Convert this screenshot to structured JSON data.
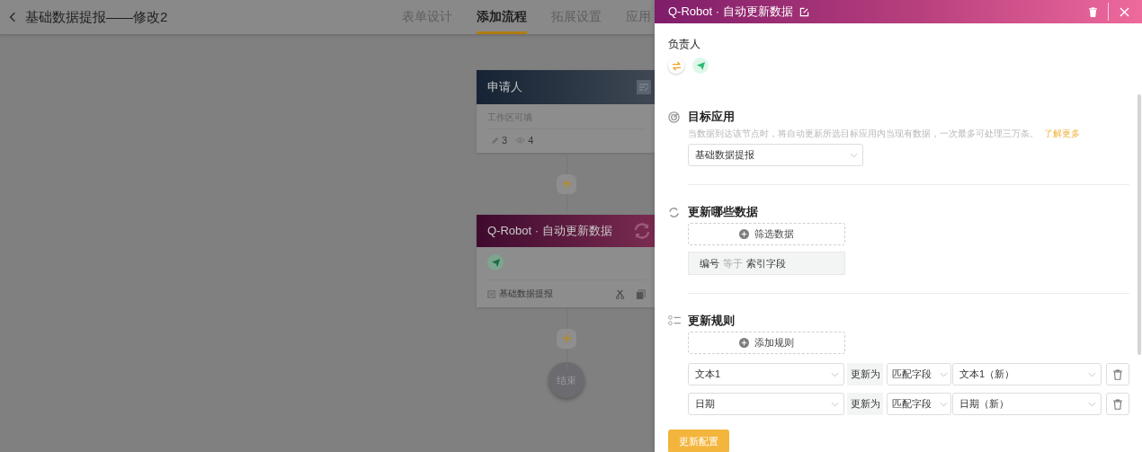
{
  "header": {
    "title": "基础数据提报——修改2",
    "tabs": [
      {
        "label": "表单设计",
        "selected": false
      },
      {
        "label": "添加流程",
        "selected": true
      },
      {
        "label": "拓展设置",
        "selected": false
      },
      {
        "label": "应用",
        "selected": false
      }
    ]
  },
  "flow": {
    "nodes": [
      {
        "kind": "applicant",
        "title": "申请人",
        "subtitle": "工作区可填",
        "edit_count": "3",
        "view_count": "4"
      },
      {
        "kind": "robot",
        "title": "Q-Robot · 自动更新数据",
        "app": "基础数据提报"
      }
    ],
    "end_label": "结束"
  },
  "panel": {
    "title": "Q-Robot · 自动更新数据",
    "owner_label": "负责人",
    "target": {
      "title": "目标应用",
      "description": "当数据到达该节点时，将自动更新所选目标应用内当现有数据，一次最多可处理三万条。",
      "link": "了解更多",
      "app": "基础数据提报"
    },
    "filter": {
      "title": "更新哪些数据",
      "add_button": "筛选数据",
      "condition": {
        "field": "编号",
        "operator": "等于",
        "value": "索引字段"
      }
    },
    "rules": {
      "title": "更新规则",
      "add_button": "添加规则",
      "items": [
        {
          "field": "文本1",
          "action": "更新为",
          "mode": "匹配字段",
          "target": "文本1（新）"
        },
        {
          "field": "日期",
          "action": "更新为",
          "mode": "匹配字段",
          "target": "日期（新）"
        }
      ]
    },
    "save_button": "更新配置"
  }
}
